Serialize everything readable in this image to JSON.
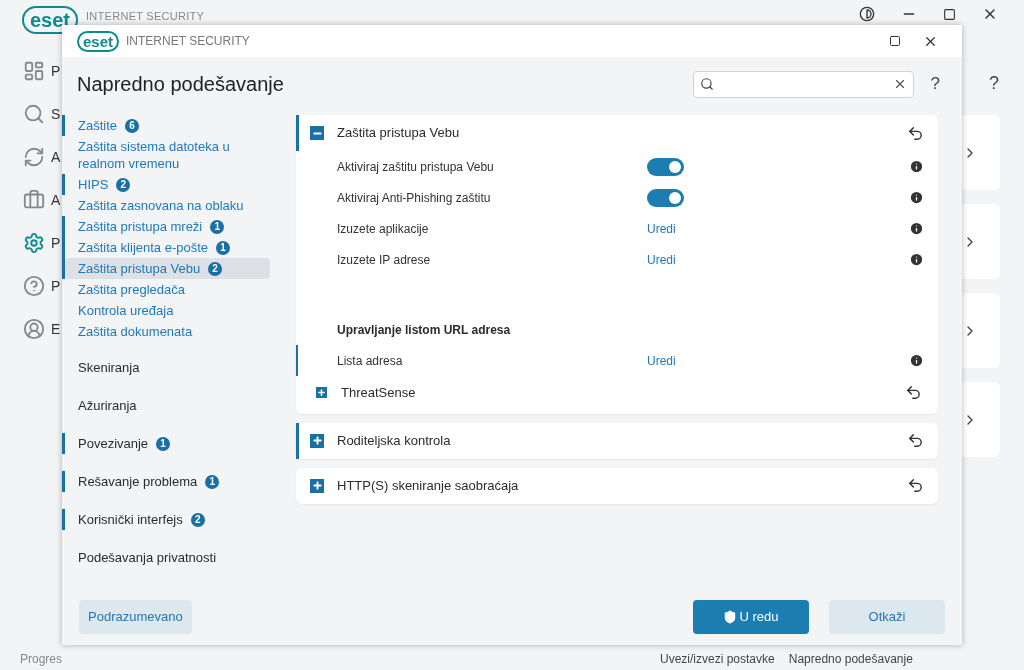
{
  "background": {
    "logo": "eset",
    "product": "INTERNET SECURITY",
    "nav": [
      {
        "kind": "dashboard",
        "letter": "P",
        "selected": false
      },
      {
        "kind": "search",
        "letter": "S",
        "selected": false
      },
      {
        "kind": "update",
        "letter": "A",
        "selected": false
      },
      {
        "kind": "tools",
        "letter": "A",
        "selected": false
      },
      {
        "kind": "settings",
        "letter": "P",
        "selected": true
      },
      {
        "kind": "help",
        "letter": "P",
        "selected": false
      },
      {
        "kind": "account",
        "letter": "E",
        "selected": false
      }
    ],
    "help": "?",
    "status": "Progres",
    "footer_links": [
      "Uvezi/izvezi postavke",
      "Napredno podešavanje"
    ]
  },
  "dialog": {
    "logo": "eset",
    "product": "INTERNET SECURITY",
    "title": "Napredno podešavanje",
    "help": "?",
    "nav": [
      {
        "label": "Zaštite",
        "badge": "6",
        "marked": true,
        "selected": false,
        "children": [
          {
            "label": "Zaštita sistema datoteka u realnom vremenu",
            "marked": false,
            "selected": false
          },
          {
            "label": "HIPS",
            "badge": "2",
            "marked": true,
            "selected": false
          },
          {
            "label": "Zaštita zasnovana na oblaku",
            "marked": false,
            "selected": false
          },
          {
            "label": "Zaštita pristupa mreži",
            "badge": "1",
            "marked": true,
            "selected": false
          },
          {
            "label": "Zaštita klijenta e-pošte",
            "badge": "1",
            "marked": true,
            "selected": false
          },
          {
            "label": "Zaštita pristupa Vebu",
            "badge": "2",
            "marked": true,
            "selected": true
          },
          {
            "label": "Zaštita pregledača",
            "marked": false,
            "selected": false
          },
          {
            "label": "Kontrola uređaja",
            "marked": false,
            "selected": false
          },
          {
            "label": "Zaštita dokumenata",
            "marked": false,
            "selected": false
          }
        ]
      },
      {
        "label": "Skeniranja",
        "marked": false,
        "selected": false
      },
      {
        "label": "Ažuriranja",
        "marked": false,
        "selected": false
      },
      {
        "label": "Povezivanje",
        "badge": "1",
        "marked": true,
        "selected": false
      },
      {
        "label": "Rešavanje problema",
        "badge": "1",
        "marked": true,
        "selected": false
      },
      {
        "label": "Korisnički interfejs",
        "badge": "2",
        "marked": true,
        "selected": false
      },
      {
        "label": "Podešavanja privatnosti",
        "marked": false,
        "selected": false
      }
    ],
    "panels": [
      {
        "title": "Zaštita pristupa Vebu",
        "expanded": true,
        "marked": true,
        "items": [
          {
            "kind": "toggle",
            "label": "Aktiviraj zaštitu pristupa Vebu",
            "on": true,
            "marked": false
          },
          {
            "kind": "toggle",
            "label": "Aktiviraj Anti-Phishing zaštitu",
            "on": true,
            "marked": false
          },
          {
            "kind": "link",
            "label": "Izuzete aplikacije",
            "link": "Uredi",
            "marked": false
          },
          {
            "kind": "link",
            "label": "Izuzete IP adrese",
            "link": "Uredi",
            "marked": false
          },
          {
            "kind": "heading",
            "label": "Upravljanje listom URL adresa"
          },
          {
            "kind": "link",
            "label": "Lista adresa",
            "link": "Uredi",
            "marked": true
          },
          {
            "kind": "subsection",
            "label": "ThreatSense",
            "expanded": false
          }
        ]
      },
      {
        "title": "Roditeljska kontrola",
        "expanded": false,
        "marked": true
      },
      {
        "title": "HTTP(S) skeniranje saobraćaja",
        "expanded": false,
        "marked": false
      }
    ],
    "buttons": {
      "default": "Podrazumevano",
      "ok": "U redu",
      "cancel": "Otkaži"
    }
  }
}
